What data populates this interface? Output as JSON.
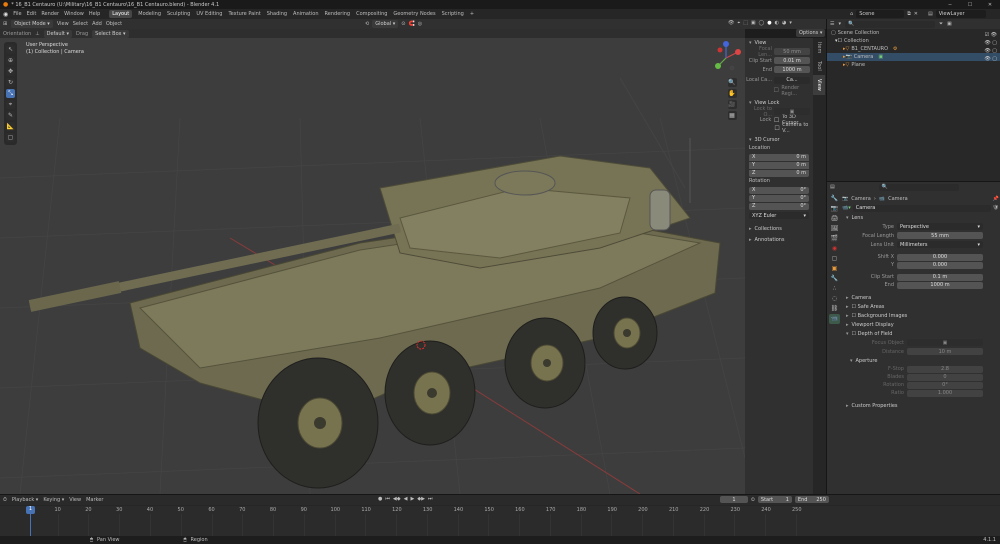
{
  "window": {
    "title": "* 16_B1 Centauro (U:\\Military\\16_B1 Centauro\\16_B1 Centauro.blend) - Blender 4.1"
  },
  "menu": [
    "File",
    "Edit",
    "Render",
    "Window",
    "Help"
  ],
  "workspaces": [
    "Layout",
    "Modeling",
    "Sculpting",
    "UV Editing",
    "Texture Paint",
    "Shading",
    "Animation",
    "Rendering",
    "Compositing",
    "Geometry Nodes",
    "Scripting"
  ],
  "scene": {
    "name": "Scene",
    "viewlayer": "ViewLayer"
  },
  "header": {
    "mode": "Object Mode",
    "view": "View",
    "select": "Select",
    "add": "Add",
    "object": "Object",
    "orient": "Global",
    "options": "Options"
  },
  "subheader": {
    "orientation_label": "Orientation",
    "orientation_value": "Default",
    "drag_label": "Drag",
    "drag_value": "Select Box"
  },
  "viewport": {
    "perspective": "User Perspective",
    "collection": "(1) Collection | Camera"
  },
  "npanel": {
    "view_title": "View",
    "focal_label": "Focal Len...",
    "focal_value": "50 mm",
    "clip_start_label": "Clip Start",
    "clip_start_value": "0.01 m",
    "end_label": "End",
    "end_value": "1000 m",
    "local_camera_label": "Local Ca...",
    "local_camera_value": "Ca...",
    "render_region": "Render Regi...",
    "viewlock_title": "View Lock",
    "lock_to_object": "Lock to O...",
    "lock_label": "Lock",
    "to_3d_cursor": "To 3D Cursor",
    "camera_to_view": "Camera to V...",
    "cursor_title": "3D Cursor",
    "location": "Location",
    "x": "X",
    "y": "Y",
    "z": "Z",
    "loc_x": "0 m",
    "loc_y": "0 m",
    "loc_z": "0 m",
    "rotation": "Rotation",
    "rot_x": "0°",
    "rot_y": "0°",
    "rot_z": "0°",
    "rot_mode": "XYZ Euler",
    "collections": "Collections",
    "annotations": "Annotations",
    "tabs": [
      "Item",
      "Tool",
      "View"
    ]
  },
  "outliner": {
    "scene_collection": "Scene Collection",
    "collection": "Collection",
    "items": [
      "B1_CENTAURO",
      "Camera",
      "Plane"
    ]
  },
  "properties": {
    "breadcrumb_obj": "Camera",
    "breadcrumb_data": "Camera",
    "data_name": "Camera",
    "lens": "Lens",
    "type_label": "Type",
    "type_value": "Perspective",
    "focal_label": "Focal Length",
    "focal_value": "55 mm",
    "lens_unit_label": "Lens Unit",
    "lens_unit_value": "Millimeters",
    "shift_x_label": "Shift X",
    "shift_x_value": "0.000",
    "y_label": "Y",
    "shift_y_value": "0.000",
    "clip_start_label": "Clip Start",
    "clip_start_value": "0.1 m",
    "end_label": "End",
    "end_value": "1000 m",
    "camera": "Camera",
    "safe_areas": "Safe Areas",
    "background_images": "Background Images",
    "viewport_display": "Viewport Display",
    "dof": "Depth of Field",
    "focus_object_label": "Focus Object",
    "distance_label": "Distance",
    "distance_value": "10 m",
    "aperture": "Aperture",
    "fstop_label": "F-Stop",
    "fstop_value": "2.8",
    "blades_label": "Blades",
    "blades_value": "0",
    "rotation_label": "Rotation",
    "rotation_value": "0°",
    "ratio_label": "Ratio",
    "ratio_value": "1.000",
    "custom_props": "Custom Properties"
  },
  "timeline": {
    "playback": "Playback",
    "keying": "Keying",
    "view": "View",
    "marker": "Marker",
    "current": "1",
    "start_label": "Start",
    "start_value": "1",
    "end_label": "End",
    "end_value": "250",
    "ticks": [
      "1",
      "10",
      "20",
      "30",
      "40",
      "50",
      "60",
      "70",
      "80",
      "90",
      "100",
      "110",
      "120",
      "130",
      "140",
      "150",
      "160",
      "170",
      "180",
      "190",
      "200",
      "210",
      "220",
      "230",
      "240",
      "250"
    ]
  },
  "status": {
    "pan": "Pan View",
    "region": "Region",
    "version": "4.1.1"
  },
  "colors": {
    "accent": "#4772b3",
    "panel": "#303030",
    "viewport": "#3d3d3d",
    "header": "#262626"
  }
}
